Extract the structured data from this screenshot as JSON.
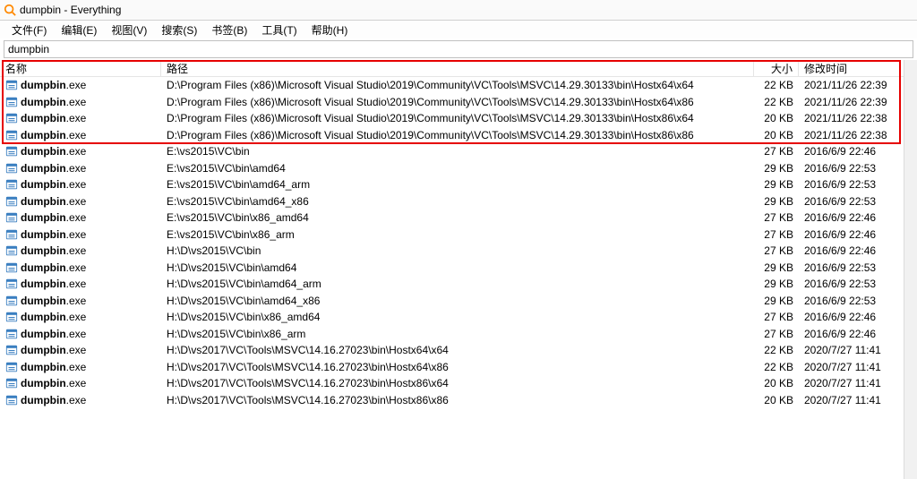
{
  "window": {
    "title": "dumpbin - Everything"
  },
  "menu": {
    "file": "文件(F)",
    "edit": "编辑(E)",
    "view": "视图(V)",
    "search": "搜索(S)",
    "bookmarks": "书签(B)",
    "tools": "工具(T)",
    "help": "帮助(H)"
  },
  "search": {
    "value": "dumpbin"
  },
  "columns": {
    "name": "名称",
    "path": "路径",
    "size": "大小",
    "date": "修改时间"
  },
  "file_bold": "dumpbin",
  "file_ext": ".exe",
  "rows": [
    {
      "path": "D:\\Program Files (x86)\\Microsoft Visual Studio\\2019\\Community\\VC\\Tools\\MSVC\\14.29.30133\\bin\\Hostx64\\x64",
      "size": "22 KB",
      "date": "2021/11/26 22:39"
    },
    {
      "path": "D:\\Program Files (x86)\\Microsoft Visual Studio\\2019\\Community\\VC\\Tools\\MSVC\\14.29.30133\\bin\\Hostx64\\x86",
      "size": "22 KB",
      "date": "2021/11/26 22:39"
    },
    {
      "path": "D:\\Program Files (x86)\\Microsoft Visual Studio\\2019\\Community\\VC\\Tools\\MSVC\\14.29.30133\\bin\\Hostx86\\x64",
      "size": "20 KB",
      "date": "2021/11/26 22:38"
    },
    {
      "path": "D:\\Program Files (x86)\\Microsoft Visual Studio\\2019\\Community\\VC\\Tools\\MSVC\\14.29.30133\\bin\\Hostx86\\x86",
      "size": "20 KB",
      "date": "2021/11/26 22:38"
    },
    {
      "path": "E:\\vs2015\\VC\\bin",
      "size": "27 KB",
      "date": "2016/6/9 22:46"
    },
    {
      "path": "E:\\vs2015\\VC\\bin\\amd64",
      "size": "29 KB",
      "date": "2016/6/9 22:53"
    },
    {
      "path": "E:\\vs2015\\VC\\bin\\amd64_arm",
      "size": "29 KB",
      "date": "2016/6/9 22:53"
    },
    {
      "path": "E:\\vs2015\\VC\\bin\\amd64_x86",
      "size": "29 KB",
      "date": "2016/6/9 22:53"
    },
    {
      "path": "E:\\vs2015\\VC\\bin\\x86_amd64",
      "size": "27 KB",
      "date": "2016/6/9 22:46"
    },
    {
      "path": "E:\\vs2015\\VC\\bin\\x86_arm",
      "size": "27 KB",
      "date": "2016/6/9 22:46"
    },
    {
      "path": "H:\\D\\vs2015\\VC\\bin",
      "size": "27 KB",
      "date": "2016/6/9 22:46"
    },
    {
      "path": "H:\\D\\vs2015\\VC\\bin\\amd64",
      "size": "29 KB",
      "date": "2016/6/9 22:53"
    },
    {
      "path": "H:\\D\\vs2015\\VC\\bin\\amd64_arm",
      "size": "29 KB",
      "date": "2016/6/9 22:53"
    },
    {
      "path": "H:\\D\\vs2015\\VC\\bin\\amd64_x86",
      "size": "29 KB",
      "date": "2016/6/9 22:53"
    },
    {
      "path": "H:\\D\\vs2015\\VC\\bin\\x86_amd64",
      "size": "27 KB",
      "date": "2016/6/9 22:46"
    },
    {
      "path": "H:\\D\\vs2015\\VC\\bin\\x86_arm",
      "size": "27 KB",
      "date": "2016/6/9 22:46"
    },
    {
      "path": "H:\\D\\vs2017\\VC\\Tools\\MSVC\\14.16.27023\\bin\\Hostx64\\x64",
      "size": "22 KB",
      "date": "2020/7/27 11:41"
    },
    {
      "path": "H:\\D\\vs2017\\VC\\Tools\\MSVC\\14.16.27023\\bin\\Hostx64\\x86",
      "size": "22 KB",
      "date": "2020/7/27 11:41"
    },
    {
      "path": "H:\\D\\vs2017\\VC\\Tools\\MSVC\\14.16.27023\\bin\\Hostx86\\x64",
      "size": "20 KB",
      "date": "2020/7/27 11:41"
    },
    {
      "path": "H:\\D\\vs2017\\VC\\Tools\\MSVC\\14.16.27023\\bin\\Hostx86\\x86",
      "size": "20 KB",
      "date": "2020/7/27 11:41"
    }
  ]
}
